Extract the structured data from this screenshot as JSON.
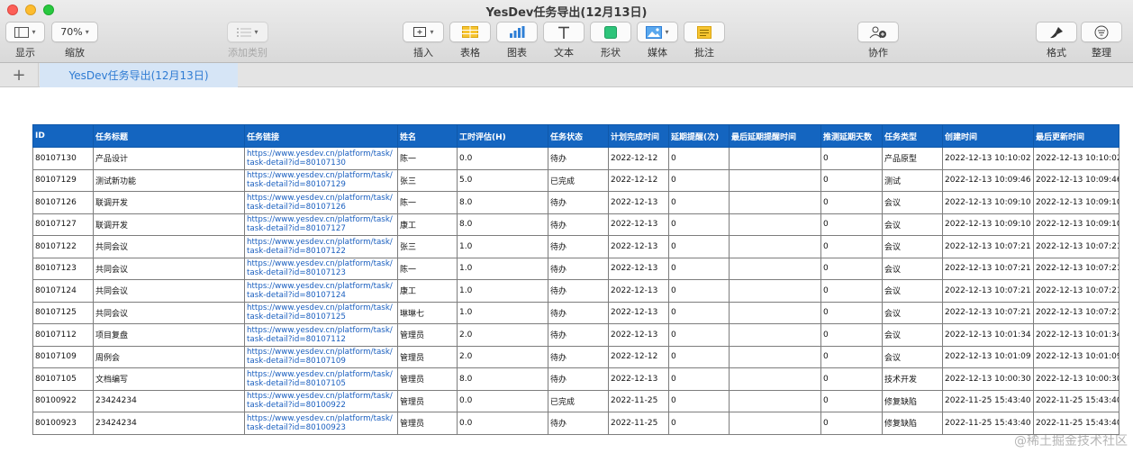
{
  "window": {
    "title": "YesDev任务导出(12月13日)"
  },
  "toolbar": {
    "view_label": "显示",
    "zoom_value": "70%",
    "zoom_label": "缩放",
    "category_label": "添加类别",
    "insert_label": "插入",
    "table_label": "表格",
    "chart_label": "图表",
    "text_label": "文本",
    "shape_label": "形状",
    "media_label": "媒体",
    "comment_label": "批注",
    "collaborate_label": "协作",
    "format_label": "格式",
    "organize_label": "整理"
  },
  "sheet": {
    "add_label": "+",
    "tab_name": "YesDev任务导出(12月13日)"
  },
  "table": {
    "headers": [
      "ID",
      "任务标题",
      "任务链接",
      "姓名",
      "工时评估(H)",
      "任务状态",
      "计划完成时间",
      "延期提醒(次)",
      "最后延期提醒时间",
      "推测延期天数",
      "任务类型",
      "创建时间",
      "最后更新时间"
    ],
    "rows": [
      {
        "id": "80107130",
        "title": "产品设计",
        "link1": "https://www.yesdev.cn/platform/task/",
        "link2": "task-detail?id=80107130",
        "name": "陈一",
        "hours": "0.0",
        "status": "待办",
        "due": "2022-12-12",
        "remind": "0",
        "last_remind": "",
        "delay": "0",
        "type": "产品原型",
        "created": "2022-12-13 10:10:02",
        "updated": "2022-12-13 10:10:02"
      },
      {
        "id": "80107129",
        "title": "测试新功能",
        "link1": "https://www.yesdev.cn/platform/task/",
        "link2": "task-detail?id=80107129",
        "name": "张三",
        "hours": "5.0",
        "status": "已完成",
        "due": "2022-12-12",
        "remind": "0",
        "last_remind": "",
        "delay": "0",
        "type": "测试",
        "created": "2022-12-13 10:09:46",
        "updated": "2022-12-13 10:09:46"
      },
      {
        "id": "80107126",
        "title": "联调开发",
        "link1": "https://www.yesdev.cn/platform/task/",
        "link2": "task-detail?id=80107126",
        "name": "陈一",
        "hours": "8.0",
        "status": "待办",
        "due": "2022-12-13",
        "remind": "0",
        "last_remind": "",
        "delay": "0",
        "type": "会议",
        "created": "2022-12-13 10:09:10",
        "updated": "2022-12-13 10:09:10"
      },
      {
        "id": "80107127",
        "title": "联调开发",
        "link1": "https://www.yesdev.cn/platform/task/",
        "link2": "task-detail?id=80107127",
        "name": "康工",
        "hours": "8.0",
        "status": "待办",
        "due": "2022-12-13",
        "remind": "0",
        "last_remind": "",
        "delay": "0",
        "type": "会议",
        "created": "2022-12-13 10:09:10",
        "updated": "2022-12-13 10:09:10"
      },
      {
        "id": "80107122",
        "title": "共同会议",
        "link1": "https://www.yesdev.cn/platform/task/",
        "link2": "task-detail?id=80107122",
        "name": "张三",
        "hours": "1.0",
        "status": "待办",
        "due": "2022-12-13",
        "remind": "0",
        "last_remind": "",
        "delay": "0",
        "type": "会议",
        "created": "2022-12-13 10:07:21",
        "updated": "2022-12-13 10:07:21"
      },
      {
        "id": "80107123",
        "title": "共同会议",
        "link1": "https://www.yesdev.cn/platform/task/",
        "link2": "task-detail?id=80107123",
        "name": "陈一",
        "hours": "1.0",
        "status": "待办",
        "due": "2022-12-13",
        "remind": "0",
        "last_remind": "",
        "delay": "0",
        "type": "会议",
        "created": "2022-12-13 10:07:21",
        "updated": "2022-12-13 10:07:21"
      },
      {
        "id": "80107124",
        "title": "共同会议",
        "link1": "https://www.yesdev.cn/platform/task/",
        "link2": "task-detail?id=80107124",
        "name": "康工",
        "hours": "1.0",
        "status": "待办",
        "due": "2022-12-13",
        "remind": "0",
        "last_remind": "",
        "delay": "0",
        "type": "会议",
        "created": "2022-12-13 10:07:21",
        "updated": "2022-12-13 10:07:21"
      },
      {
        "id": "80107125",
        "title": "共同会议",
        "link1": "https://www.yesdev.cn/platform/task/",
        "link2": "task-detail?id=80107125",
        "name": "琳琳七",
        "hours": "1.0",
        "status": "待办",
        "due": "2022-12-13",
        "remind": "0",
        "last_remind": "",
        "delay": "0",
        "type": "会议",
        "created": "2022-12-13 10:07:21",
        "updated": "2022-12-13 10:07:21"
      },
      {
        "id": "80107112",
        "title": "项目复盘",
        "link1": "https://www.yesdev.cn/platform/task/",
        "link2": "task-detail?id=80107112",
        "name": "管理员",
        "hours": "2.0",
        "status": "待办",
        "due": "2022-12-13",
        "remind": "0",
        "last_remind": "",
        "delay": "0",
        "type": "会议",
        "created": "2022-12-13 10:01:34",
        "updated": "2022-12-13 10:01:34"
      },
      {
        "id": "80107109",
        "title": "周例会",
        "link1": "https://www.yesdev.cn/platform/task/",
        "link2": "task-detail?id=80107109",
        "name": "管理员",
        "hours": "2.0",
        "status": "待办",
        "due": "2022-12-12",
        "remind": "0",
        "last_remind": "",
        "delay": "0",
        "type": "会议",
        "created": "2022-12-13 10:01:09",
        "updated": "2022-12-13 10:01:09"
      },
      {
        "id": "80107105",
        "title": "文档编写",
        "link1": "https://www.yesdev.cn/platform/task/",
        "link2": "task-detail?id=80107105",
        "name": "管理员",
        "hours": "8.0",
        "status": "待办",
        "due": "2022-12-13",
        "remind": "0",
        "last_remind": "",
        "delay": "0",
        "type": "技术开发",
        "created": "2022-12-13 10:00:30",
        "updated": "2022-12-13 10:00:30"
      },
      {
        "id": "80100922",
        "title": "23424234",
        "link1": "https://www.yesdev.cn/platform/task/",
        "link2": "task-detail?id=80100922",
        "name": "管理员",
        "hours": "0.0",
        "status": "已完成",
        "due": "2022-11-25",
        "remind": "0",
        "last_remind": "",
        "delay": "0",
        "type": "修复缺陷",
        "created": "2022-11-25 15:43:40",
        "updated": "2022-11-25 15:43:40"
      },
      {
        "id": "80100923",
        "title": "23424234",
        "link1": "https://www.yesdev.cn/platform/task/",
        "link2": "task-detail?id=80100923",
        "name": "管理员",
        "hours": "0.0",
        "status": "待办",
        "due": "2022-11-25",
        "remind": "0",
        "last_remind": "",
        "delay": "0",
        "type": "修复缺陷",
        "created": "2022-11-25 15:43:40",
        "updated": "2022-11-25 15:43:40"
      }
    ]
  },
  "watermark": "@稀土掘金技术社区"
}
